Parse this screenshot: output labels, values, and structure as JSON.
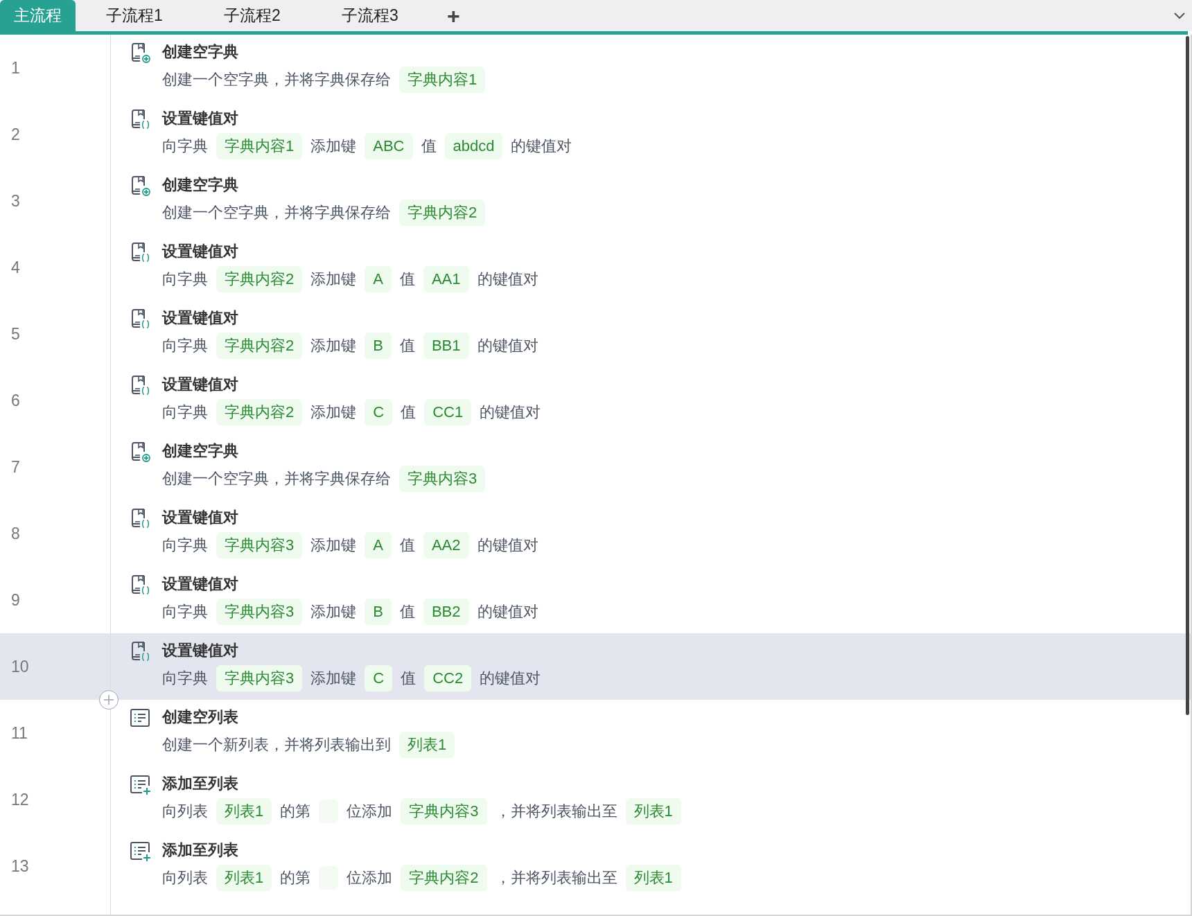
{
  "tabs": [
    {
      "label": "主流程",
      "selected": true
    },
    {
      "label": "子流程1",
      "selected": false
    },
    {
      "label": "子流程2",
      "selected": false
    },
    {
      "label": "子流程3",
      "selected": false
    }
  ],
  "add_tab": "+",
  "steps": [
    {
      "number": "1",
      "kind": "dict_create",
      "title": "创建空字典",
      "selected": false,
      "parts": [
        {
          "kind": "text",
          "text": "创建一个空字典，并将字典保存给"
        },
        {
          "kind": "var",
          "text": "字典内容1"
        }
      ]
    },
    {
      "number": "2",
      "kind": "dict_set",
      "title": "设置键值对",
      "selected": false,
      "parts": [
        {
          "kind": "text",
          "text": "向字典"
        },
        {
          "kind": "var",
          "text": "字典内容1"
        },
        {
          "kind": "text",
          "text": "添加键"
        },
        {
          "kind": "var",
          "text": "ABC"
        },
        {
          "kind": "text",
          "text": "值"
        },
        {
          "kind": "var",
          "text": "abdcd"
        },
        {
          "kind": "text",
          "text": "的键值对"
        }
      ]
    },
    {
      "number": "3",
      "kind": "dict_create",
      "title": "创建空字典",
      "selected": false,
      "parts": [
        {
          "kind": "text",
          "text": "创建一个空字典，并将字典保存给"
        },
        {
          "kind": "var",
          "text": "字典内容2"
        }
      ]
    },
    {
      "number": "4",
      "kind": "dict_set",
      "title": "设置键值对",
      "selected": false,
      "parts": [
        {
          "kind": "text",
          "text": "向字典"
        },
        {
          "kind": "var",
          "text": "字典内容2"
        },
        {
          "kind": "text",
          "text": "添加键"
        },
        {
          "kind": "var",
          "text": "A"
        },
        {
          "kind": "text",
          "text": "值"
        },
        {
          "kind": "var",
          "text": "AA1"
        },
        {
          "kind": "text",
          "text": "的键值对"
        }
      ]
    },
    {
      "number": "5",
      "kind": "dict_set",
      "title": "设置键值对",
      "selected": false,
      "parts": [
        {
          "kind": "text",
          "text": "向字典"
        },
        {
          "kind": "var",
          "text": "字典内容2"
        },
        {
          "kind": "text",
          "text": "添加键"
        },
        {
          "kind": "var",
          "text": "B"
        },
        {
          "kind": "text",
          "text": "值"
        },
        {
          "kind": "var",
          "text": "BB1"
        },
        {
          "kind": "text",
          "text": "的键值对"
        }
      ]
    },
    {
      "number": "6",
      "kind": "dict_set",
      "title": "设置键值对",
      "selected": false,
      "parts": [
        {
          "kind": "text",
          "text": "向字典"
        },
        {
          "kind": "var",
          "text": "字典内容2"
        },
        {
          "kind": "text",
          "text": "添加键"
        },
        {
          "kind": "var",
          "text": "C"
        },
        {
          "kind": "text",
          "text": "值"
        },
        {
          "kind": "var",
          "text": "CC1"
        },
        {
          "kind": "text",
          "text": "的键值对"
        }
      ]
    },
    {
      "number": "7",
      "kind": "dict_create",
      "title": "创建空字典",
      "selected": false,
      "parts": [
        {
          "kind": "text",
          "text": "创建一个空字典，并将字典保存给"
        },
        {
          "kind": "var",
          "text": "字典内容3"
        }
      ]
    },
    {
      "number": "8",
      "kind": "dict_set",
      "title": "设置键值对",
      "selected": false,
      "parts": [
        {
          "kind": "text",
          "text": "向字典"
        },
        {
          "kind": "var",
          "text": "字典内容3"
        },
        {
          "kind": "text",
          "text": "添加键"
        },
        {
          "kind": "var",
          "text": "A"
        },
        {
          "kind": "text",
          "text": "值"
        },
        {
          "kind": "var",
          "text": "AA2"
        },
        {
          "kind": "text",
          "text": "的键值对"
        }
      ]
    },
    {
      "number": "9",
      "kind": "dict_set",
      "title": "设置键值对",
      "selected": false,
      "parts": [
        {
          "kind": "text",
          "text": "向字典"
        },
        {
          "kind": "var",
          "text": "字典内容3"
        },
        {
          "kind": "text",
          "text": "添加键"
        },
        {
          "kind": "var",
          "text": "B"
        },
        {
          "kind": "text",
          "text": "值"
        },
        {
          "kind": "var",
          "text": "BB2"
        },
        {
          "kind": "text",
          "text": "的键值对"
        }
      ]
    },
    {
      "number": "10",
      "kind": "dict_set",
      "title": "设置键值对",
      "selected": true,
      "parts": [
        {
          "kind": "text",
          "text": "向字典"
        },
        {
          "kind": "var",
          "text": "字典内容3"
        },
        {
          "kind": "text",
          "text": "添加键"
        },
        {
          "kind": "var",
          "text": "C"
        },
        {
          "kind": "text",
          "text": "值"
        },
        {
          "kind": "var",
          "text": "CC2"
        },
        {
          "kind": "text",
          "text": "的键值对"
        }
      ]
    },
    {
      "number": "11",
      "kind": "list_create",
      "title": "创建空列表",
      "selected": false,
      "parts": [
        {
          "kind": "text",
          "text": "创建一个新列表，并将列表输出到"
        },
        {
          "kind": "var",
          "text": "列表1"
        }
      ]
    },
    {
      "number": "12",
      "kind": "list_add",
      "title": "添加至列表",
      "selected": false,
      "parts": [
        {
          "kind": "text",
          "text": "向列表"
        },
        {
          "kind": "var",
          "text": "列表1"
        },
        {
          "kind": "text",
          "text": "的第"
        },
        {
          "kind": "blank"
        },
        {
          "kind": "text",
          "text": "位添加"
        },
        {
          "kind": "var",
          "text": "字典内容3"
        },
        {
          "kind": "text",
          "text": "，并将列表输出至"
        },
        {
          "kind": "var",
          "text": "列表1"
        }
      ]
    },
    {
      "number": "13",
      "kind": "list_add",
      "title": "添加至列表",
      "selected": false,
      "parts": [
        {
          "kind": "text",
          "text": "向列表"
        },
        {
          "kind": "var",
          "text": "列表1"
        },
        {
          "kind": "text",
          "text": "的第"
        },
        {
          "kind": "blank"
        },
        {
          "kind": "text",
          "text": "位添加"
        },
        {
          "kind": "var",
          "text": "字典内容2"
        },
        {
          "kind": "text",
          "text": "，并将列表输出至"
        },
        {
          "kind": "var",
          "text": "列表1"
        }
      ]
    }
  ]
}
